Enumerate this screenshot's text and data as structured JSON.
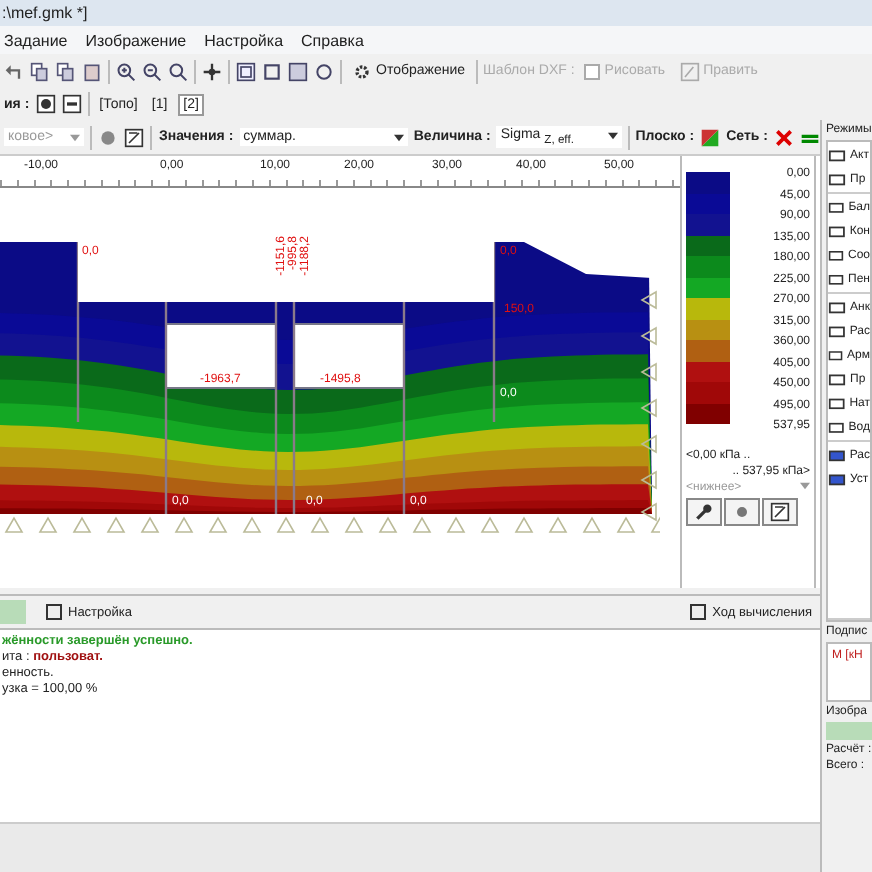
{
  "window": {
    "title": ":\\mef.gmk *]"
  },
  "menu": [
    {
      "label": "Задание"
    },
    {
      "label": "Изображение"
    },
    {
      "label": "Настройка"
    },
    {
      "label": "Справка"
    }
  ],
  "toolbar": {
    "display_button": "Отображение",
    "dxf_label": "Шаблон DXF :",
    "draw_checkbox": {
      "label": "Рисовать",
      "checked": false,
      "disabled": true
    },
    "edit_button": {
      "label": "Править",
      "disabled": true
    }
  },
  "stages": {
    "label": "ия :",
    "tabs": [
      {
        "label": "[Топо]",
        "selected": false
      },
      {
        "label": "[1]",
        "selected": false
      },
      {
        "label": "[2]",
        "selected": true
      }
    ]
  },
  "view_bar": {
    "mode_value": "ковое>",
    "values_label": "Значения :",
    "values_value": "суммар.",
    "quantity_label": "Величина :",
    "quantity_value": "Sigma $_{Z, eff.}$",
    "flat_label": "Плоско :",
    "mesh_label": "Сеть :"
  },
  "ruler": {
    "ticks": [
      "-10,00",
      "0,00",
      "10,00",
      "20,00",
      "30,00",
      "40,00",
      "50,00"
    ]
  },
  "plot": {
    "labels": [
      "0,0",
      "-1151,6",
      "-995,8",
      "-1188,2",
      "0,0",
      "150,0",
      "-1963,7",
      "-1495,8",
      "0,0",
      "0,0",
      "0,0",
      "0,0"
    ]
  },
  "legend": {
    "bands": [
      {
        "color": "#0b0b86"
      },
      {
        "color": "#0a0a96"
      },
      {
        "color": "#121290"
      },
      {
        "color": "#0a6a1a"
      },
      {
        "color": "#0c8a1c"
      },
      {
        "color": "#14a824"
      },
      {
        "color": "#b8b80c"
      },
      {
        "color": "#b89012"
      },
      {
        "color": "#b06012"
      },
      {
        "color": "#b01010"
      },
      {
        "color": "#a00808"
      },
      {
        "color": "#800000"
      }
    ],
    "values": [
      "0,00",
      "45,00",
      "90,00",
      "135,00",
      "180,00",
      "225,00",
      "270,00",
      "315,00",
      "360,00",
      "405,00",
      "450,00",
      "495,00",
      "537,95"
    ],
    "range_from": "<0,00 кПа ..",
    "range_to": ".. 537,95 кПа>",
    "scale": "<нижнее>"
  },
  "modes": {
    "title": "Режимы",
    "groups": [
      [
        {
          "label": "Акт"
        },
        {
          "label": "Пр"
        }
      ],
      [
        {
          "label": "Бал"
        },
        {
          "label": "Кон"
        },
        {
          "label": "Соо"
        },
        {
          "label": "Пен"
        }
      ],
      [
        {
          "label": "Анк"
        },
        {
          "label": "Рас"
        },
        {
          "label": "Арм"
        },
        {
          "label": "Пр"
        },
        {
          "label": "Нат"
        },
        {
          "label": "Вод"
        }
      ],
      [
        {
          "label": "Рас"
        },
        {
          "label": "Уст"
        }
      ]
    ]
  },
  "labels_panel": {
    "title": "Подпис",
    "value": "М [кН"
  },
  "image_panel": {
    "title": "Изобра",
    "calc": "Расчёт :",
    "total": "Всего :"
  },
  "bottom_tabs": {
    "settings": "Настройка",
    "progress": "Ход вычисления"
  },
  "log": [
    {
      "kind": "success",
      "text": "жённости завершён успешно."
    },
    {
      "kind": "plain",
      "text": "ита : **пользоват.**"
    },
    {
      "kind": "plain",
      "text": "енность."
    },
    {
      "kind": "plain",
      "text": "узка = 100,00 %"
    }
  ]
}
